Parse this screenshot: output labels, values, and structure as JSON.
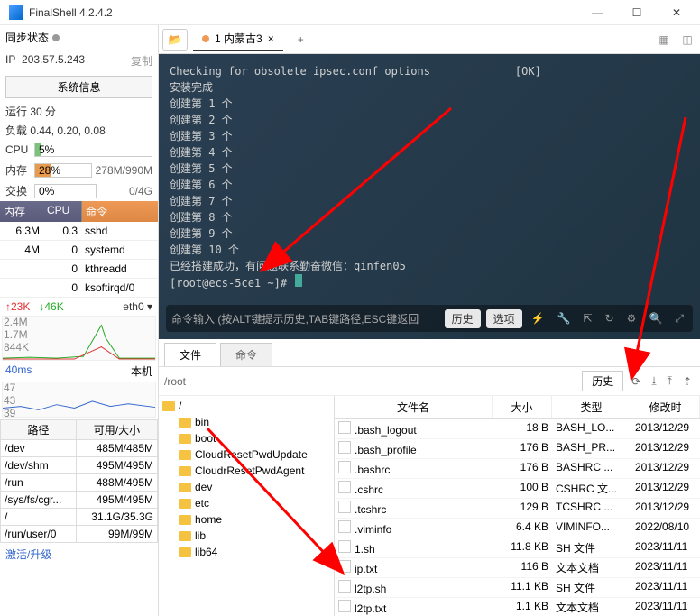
{
  "window": {
    "title": "FinalShell 4.2.4.2",
    "min": "—",
    "max": "☐",
    "close": "✕"
  },
  "left": {
    "sync_label": "同步状态",
    "ip_label": "IP",
    "ip": "203.57.5.243",
    "copy": "复制",
    "sysinfo_btn": "系统信息",
    "runtime": "运行 30 分",
    "load": "负载 0.44, 0.20, 0.08",
    "cpu": {
      "label": "CPU",
      "pct": "5%",
      "fill": 5,
      "color": "#7ac47a"
    },
    "mem": {
      "label": "内存",
      "pct": "28%",
      "val": "278M/990M",
      "fill": 28,
      "color": "#e99a4a"
    },
    "swap": {
      "label": "交换",
      "pct": "0%",
      "val": "0/4G",
      "fill": 0
    },
    "proc_hdr": {
      "mem": "内存",
      "cpu": "CPU",
      "cmd": "命令"
    },
    "procs": [
      {
        "mem": "6.3M",
        "cpu": "0.3",
        "cmd": "sshd"
      },
      {
        "mem": "4M",
        "cpu": "0",
        "cmd": "systemd"
      },
      {
        "mem": "",
        "cpu": "0",
        "cmd": "kthreadd"
      },
      {
        "mem": "",
        "cpu": "0",
        "cmd": "ksoftirqd/0"
      }
    ],
    "net": {
      "up": "↑23K",
      "dn": "↓46K",
      "iface": "eth0 ▾",
      "y1": "2.4M",
      "y2": "1.7M",
      "y3": "844K"
    },
    "ping": {
      "ms": "40ms",
      "loc": "本机",
      "y1": "47",
      "y2": "43",
      "y3": "39"
    },
    "disk_hdr": {
      "path": "路径",
      "size": "可用/大小"
    },
    "disks": [
      {
        "path": "/dev",
        "size": "485M/485M"
      },
      {
        "path": "/dev/shm",
        "size": "495M/495M"
      },
      {
        "path": "/run",
        "size": "488M/495M"
      },
      {
        "path": "/sys/fs/cgr...",
        "size": "495M/495M"
      },
      {
        "path": "/",
        "size": "31.1G/35.3G"
      },
      {
        "path": "/run/user/0",
        "size": "99M/99M"
      }
    ],
    "activate": "激活/升级"
  },
  "tabs": {
    "current": "1 内蒙古3",
    "plus": "+"
  },
  "terminal": {
    "lines": [
      "Checking for obsolete ipsec.conf options             [OK]",
      "安装完成",
      "创建第 1 个",
      "创建第 2 个",
      "创建第 3 个",
      "创建第 4 个",
      "创建第 5 个",
      "创建第 6 个",
      "创建第 7 个",
      "创建第 8 个",
      "创建第 9 个",
      "创建第 10 个",
      "已经搭建成功，有问题联系勤奋微信：qinfen05",
      "[root@ecs-5ce1 ~]# "
    ],
    "cmdbar": {
      "hint": "命令输入 (按ALT键提示历史,TAB键路径,ESC键返回",
      "hist": "历史",
      "opt": "选项"
    }
  },
  "filetabs": {
    "files": "文件",
    "cmd": "命令"
  },
  "pathbar": {
    "path": "/root",
    "hist": "历史"
  },
  "tree": {
    "root": "/",
    "nodes": [
      "bin",
      "boot",
      "CloudResetPwdUpdate",
      "CloudrResetPwdAgent",
      "dev",
      "etc",
      "home",
      "lib",
      "lib64"
    ]
  },
  "filehdr": {
    "name": "文件名",
    "size": "大小",
    "type": "类型",
    "date": "修改时"
  },
  "files": [
    {
      "name": ".bash_logout",
      "size": "18 B",
      "type": "BASH_LO...",
      "date": "2013/12/29"
    },
    {
      "name": ".bash_profile",
      "size": "176 B",
      "type": "BASH_PR...",
      "date": "2013/12/29"
    },
    {
      "name": ".bashrc",
      "size": "176 B",
      "type": "BASHRC ...",
      "date": "2013/12/29"
    },
    {
      "name": ".cshrc",
      "size": "100 B",
      "type": "CSHRC 文...",
      "date": "2013/12/29"
    },
    {
      "name": ".tcshrc",
      "size": "129 B",
      "type": "TCSHRC ...",
      "date": "2013/12/29"
    },
    {
      "name": ".viminfo",
      "size": "6.4 KB",
      "type": "VIMINFO...",
      "date": "2022/08/10"
    },
    {
      "name": "1.sh",
      "size": "11.8 KB",
      "type": "SH 文件",
      "date": "2023/11/11"
    },
    {
      "name": "ip.txt",
      "size": "116 B",
      "type": "文本文档",
      "date": "2023/11/11"
    },
    {
      "name": "l2tp.sh",
      "size": "11.1 KB",
      "type": "SH 文件",
      "date": "2023/11/11"
    },
    {
      "name": "l2tp.txt",
      "size": "1.1 KB",
      "type": "文本文档",
      "date": "2023/11/11"
    }
  ]
}
